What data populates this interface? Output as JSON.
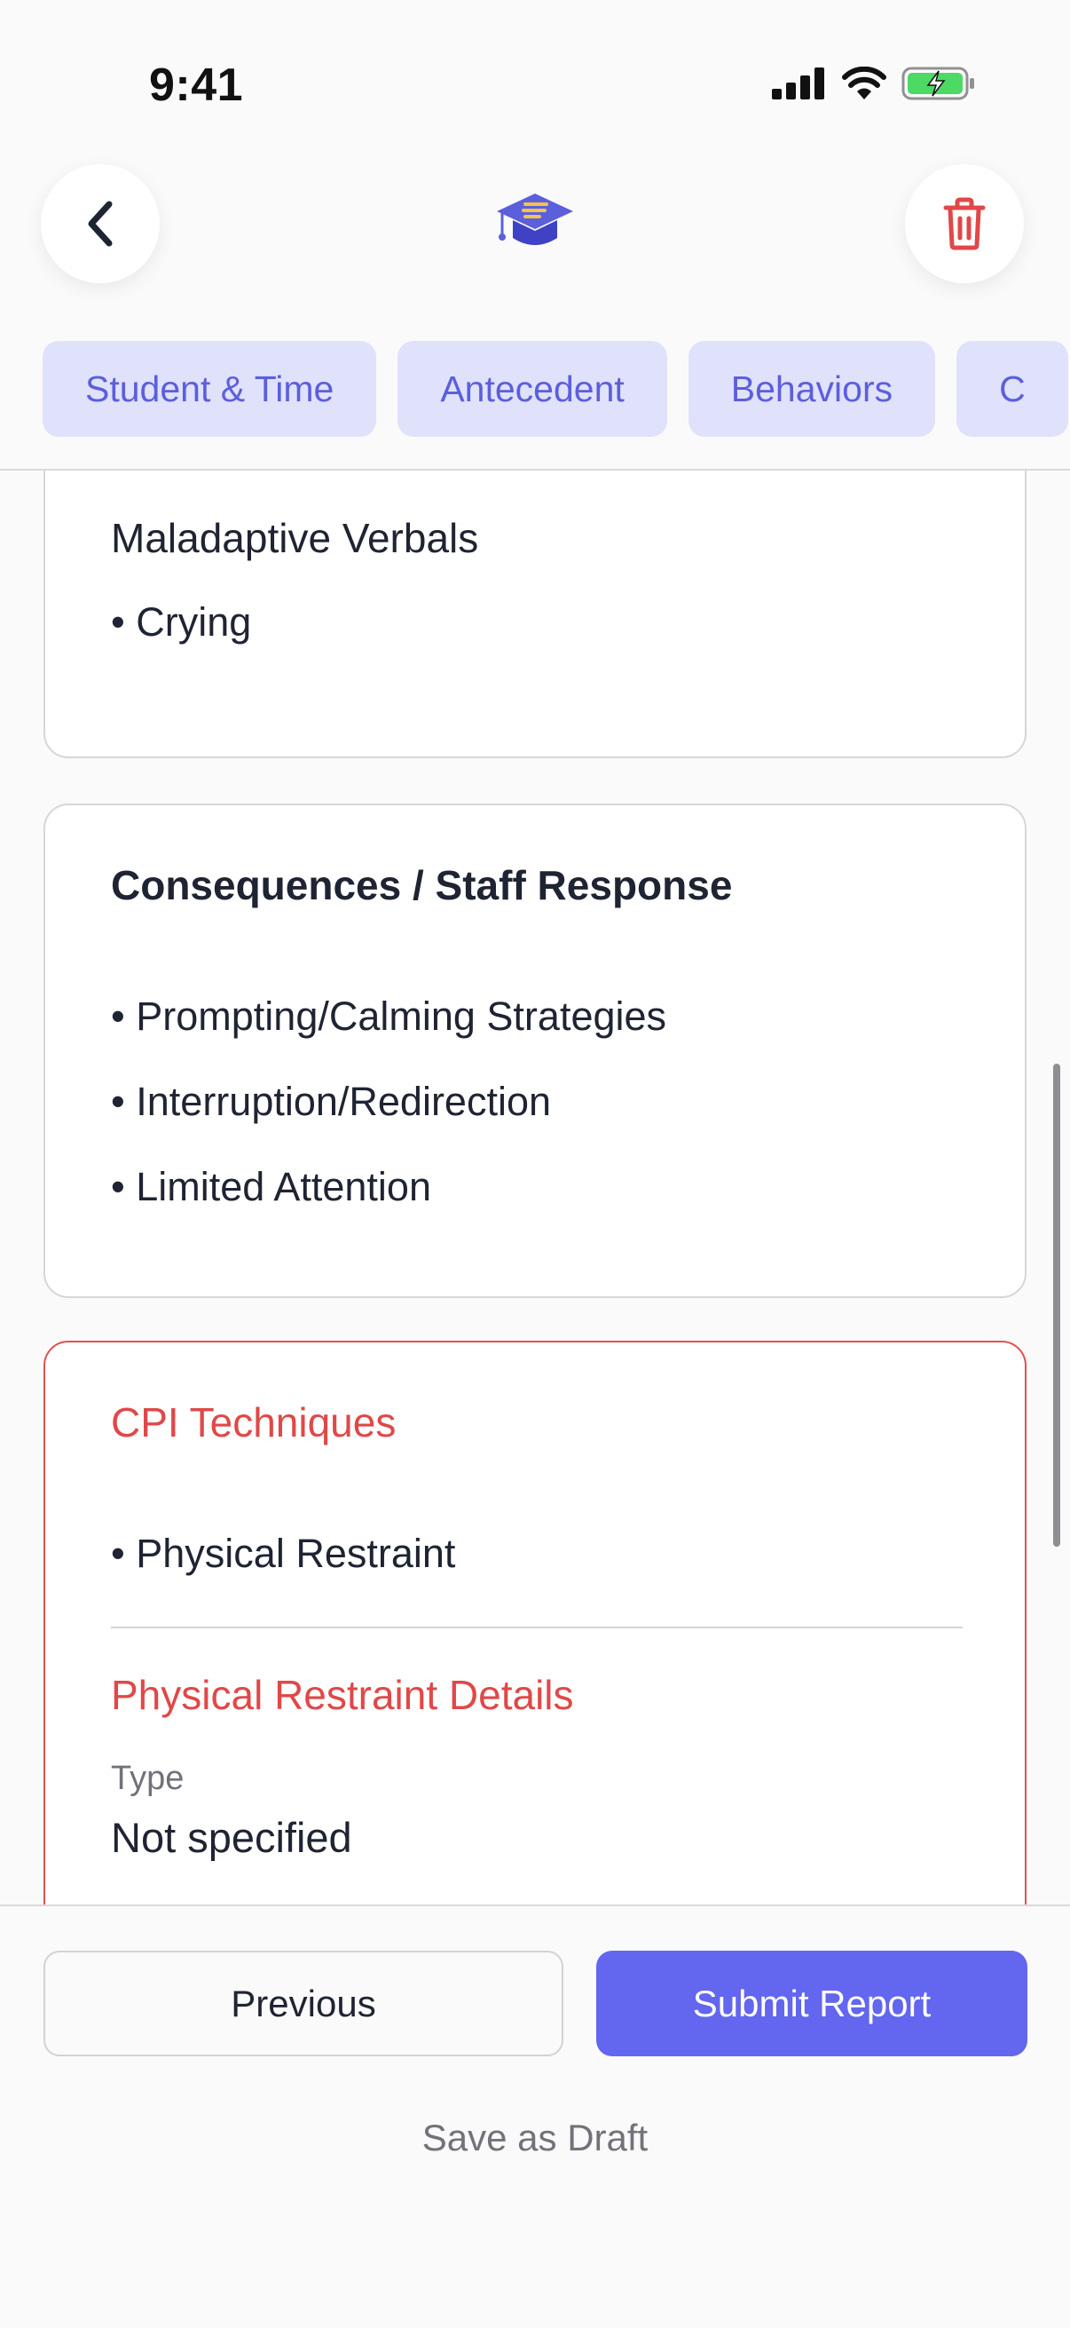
{
  "status_bar": {
    "time": "9:41",
    "icons": [
      "cellular-signal-icon",
      "wifi-icon",
      "battery-charging-icon"
    ],
    "battery_color": "#4cd964"
  },
  "header": {
    "back_icon": "chevron-left-icon",
    "logo_icon": "graduation-cap-icon",
    "delete_icon": "trash-icon",
    "accent_color": "#5b5fdc",
    "danger_color": "#e04848"
  },
  "tabs": [
    {
      "label": "Student & Time"
    },
    {
      "label": "Antecedent"
    },
    {
      "label": "Behaviors"
    },
    {
      "label": "C"
    }
  ],
  "sections": {
    "maladaptive": {
      "title": "Maladaptive Verbals",
      "items": [
        "• Crying"
      ]
    },
    "consequences": {
      "title": "Consequences / Staff Response",
      "items": [
        "• Prompting/Calming Strategies",
        "• Interruption/Redirection",
        "• Limited Attention"
      ]
    },
    "cpi": {
      "title": "CPI Techniques",
      "items": [
        "• Physical Restraint"
      ],
      "details_title": "Physical Restraint Details",
      "type_label": "Type",
      "type_value": "Not specified"
    }
  },
  "footer": {
    "previous_label": "Previous",
    "submit_label": "Submit Report",
    "save_draft_label": "Save as Draft"
  }
}
